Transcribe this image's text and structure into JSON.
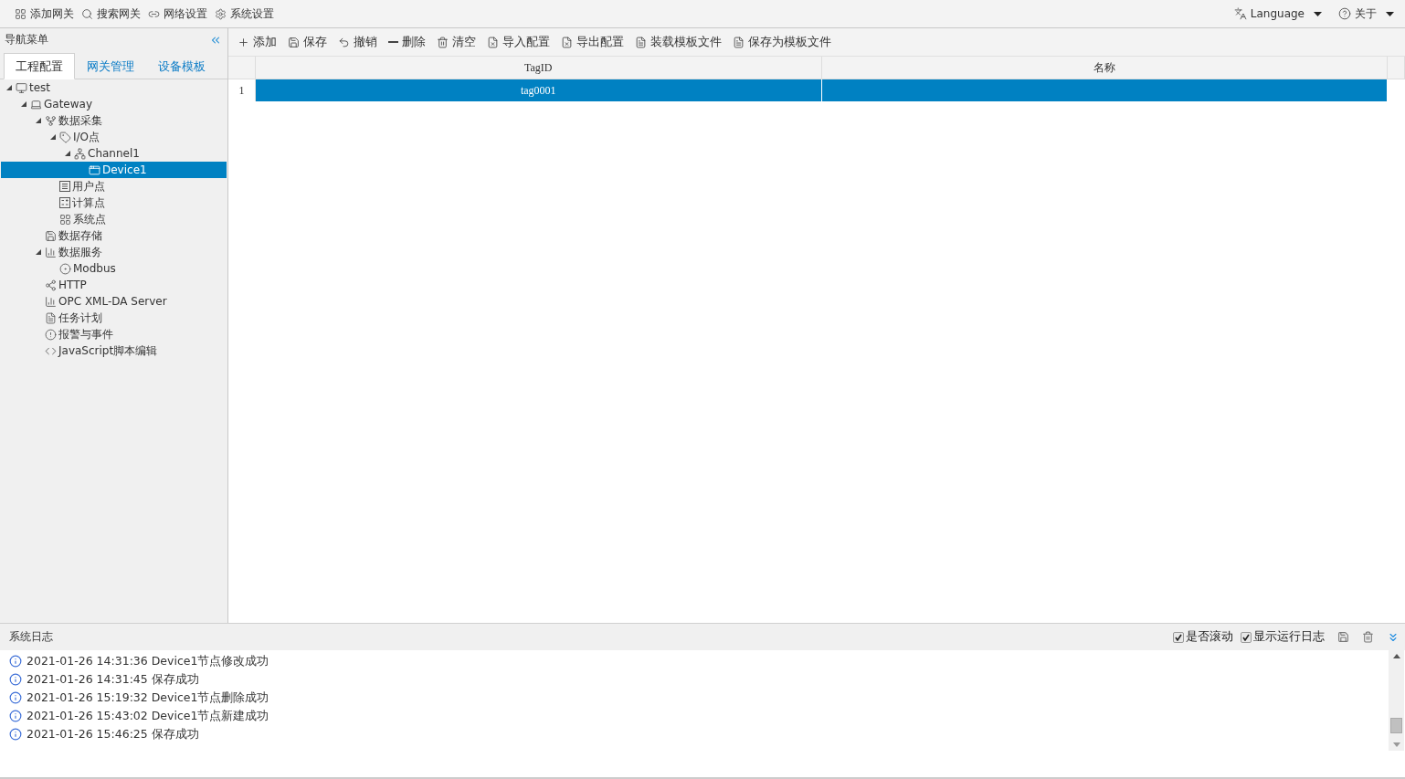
{
  "menu_bar": {
    "items": [
      {
        "kind": "grid",
        "label": "添加网关"
      },
      {
        "kind": "search",
        "label": "搜索网关"
      },
      {
        "kind": "link",
        "label": "网络设置"
      },
      {
        "kind": "gear",
        "label": "系统设置"
      }
    ],
    "right_items": [
      {
        "kind": "language",
        "label": "Language"
      },
      {
        "kind": "help",
        "label": "关于"
      }
    ]
  },
  "sidebar": {
    "title": "导航菜单",
    "tabs": [
      {
        "label": "工程配置",
        "selected": true
      },
      {
        "label": "网关管理",
        "selected": false
      },
      {
        "label": "设备模板",
        "selected": false
      }
    ],
    "tree": [
      {
        "kind": "monitor",
        "label": "test",
        "expanded": true,
        "selected": false,
        "children": [
          {
            "kind": "laptop",
            "label": "Gateway",
            "expanded": true,
            "selected": false,
            "children": [
              {
                "kind": "fork",
                "label": "数据采集",
                "expanded": true,
                "selected": false,
                "children": [
                  {
                    "kind": "tag",
                    "label": "I/O点",
                    "expanded": true,
                    "selected": false,
                    "children": [
                      {
                        "kind": "network",
                        "label": "Channel1",
                        "expanded": true,
                        "selected": false,
                        "children": [
                          {
                            "kind": "window",
                            "label": "Device1",
                            "selected": true
                          }
                        ]
                      }
                    ]
                  },
                  {
                    "kind": "list",
                    "label": "用户点",
                    "selected": false
                  },
                  {
                    "kind": "calc",
                    "label": "计算点",
                    "selected": false
                  },
                  {
                    "kind": "grid",
                    "label": "系统点",
                    "selected": false
                  }
                ]
              },
              {
                "kind": "save",
                "label": "数据存储",
                "selected": false
              },
              {
                "kind": "chart",
                "label": "数据服务",
                "expanded": true,
                "selected": false,
                "children": [
                  {
                    "kind": "modbus",
                    "label": "Modbus",
                    "selected": false
                  }
                ]
              },
              {
                "kind": "share",
                "label": "HTTP",
                "selected": false
              },
              {
                "kind": "chart",
                "label": "OPC XML-DA Server",
                "selected": false
              },
              {
                "kind": "doc",
                "label": "任务计划",
                "selected": false
              },
              {
                "kind": "alert",
                "label": "报警与事件",
                "selected": false
              },
              {
                "kind": "code",
                "label": "JavaScript脚本编辑",
                "selected": false
              }
            ]
          }
        ]
      }
    ]
  },
  "toolbar": [
    {
      "kind": "plus",
      "label": "添加"
    },
    {
      "kind": "save",
      "label": "保存"
    },
    {
      "kind": "undo",
      "label": "撤销"
    },
    {
      "kind": "minus",
      "label": "删除"
    },
    {
      "kind": "trash",
      "label": "清空"
    },
    {
      "kind": "filex",
      "label": "导入配置"
    },
    {
      "kind": "filex",
      "label": "导出配置"
    },
    {
      "kind": "doc",
      "label": "装载模板文件"
    },
    {
      "kind": "doc",
      "label": "保存为模板文件"
    }
  ],
  "table": {
    "columns": [
      "TagID",
      "名称"
    ],
    "rows": [
      {
        "index": "1",
        "cells": [
          "tag0001",
          ""
        ],
        "selected": true
      }
    ]
  },
  "log": {
    "title": "系统日志",
    "options": [
      {
        "label": "是否滚动",
        "checked": true
      },
      {
        "label": "显示运行日志",
        "checked": true
      }
    ],
    "entries": [
      "2021-01-26 14:31:36 Device1节点修改成功",
      "2021-01-26 14:31:45 保存成功",
      "2021-01-26 15:19:32 Device1节点删除成功",
      "2021-01-26 15:43:02 Device1节点新建成功",
      "2021-01-26 15:46:25 保存成功"
    ]
  }
}
